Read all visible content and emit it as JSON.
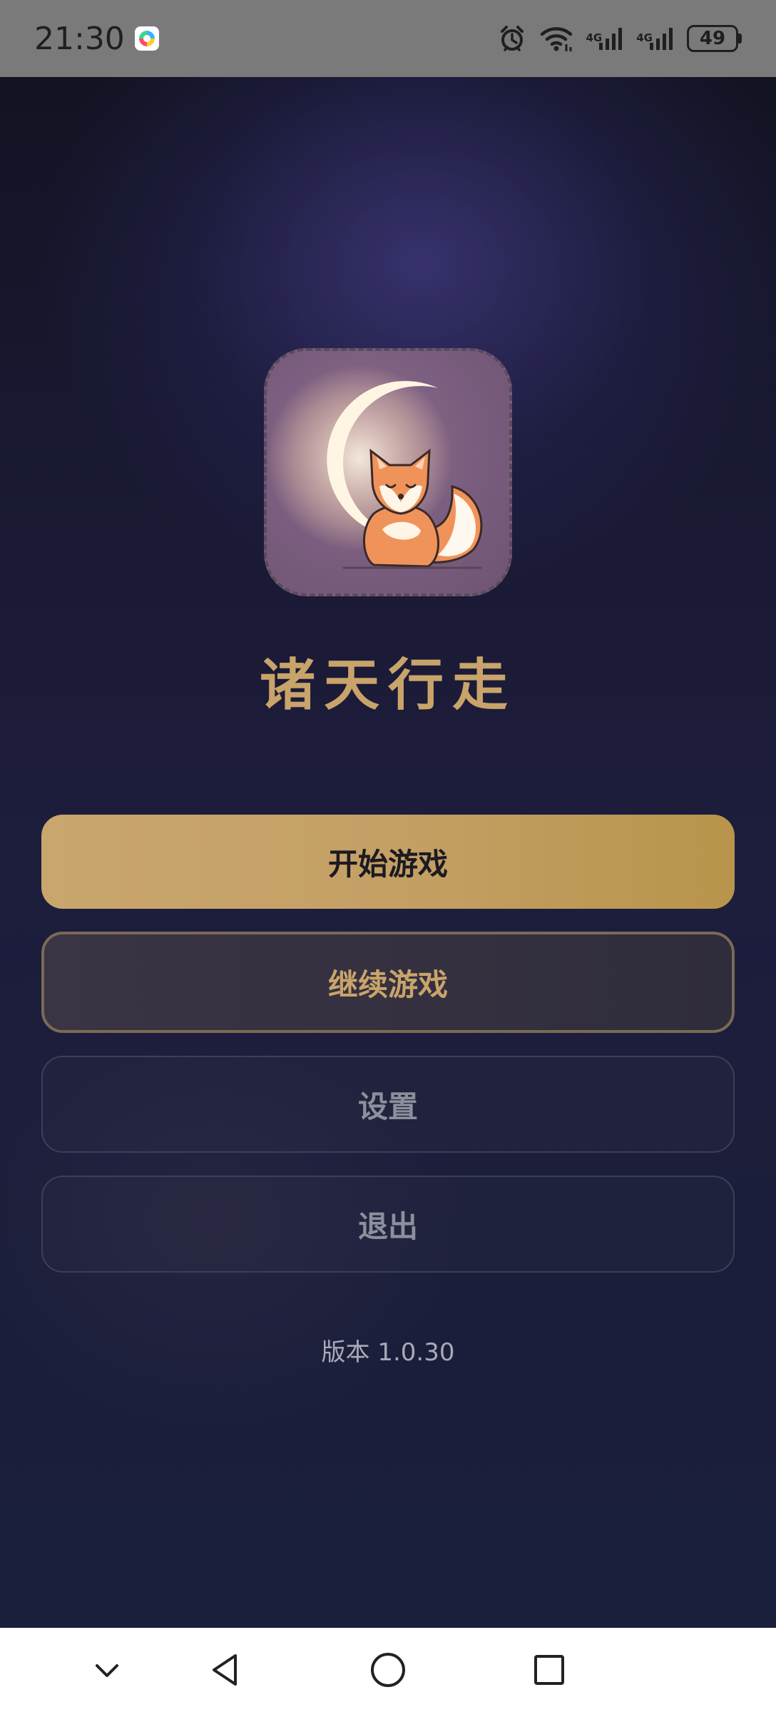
{
  "status_bar": {
    "time": "21:30",
    "app_icon": "multicolor-app-icon",
    "alarm_icon": "alarm-icon",
    "wifi_icon": "wifi-icon",
    "network1": "4G",
    "network2": "4G",
    "battery_level": "49"
  },
  "game": {
    "logo": "crescent-moon-fox-logo",
    "title": "诸天行走",
    "buttons": {
      "start": "开始游戏",
      "continue": "继续游戏",
      "settings": "设置",
      "exit": "退出"
    },
    "version": "版本 1.0.30"
  },
  "nav_bar": {
    "items": [
      "chevron-down-icon",
      "back-triangle-icon",
      "home-circle-icon",
      "recents-square-icon"
    ]
  },
  "colors": {
    "accent_gold": "#c9a46a",
    "background_dark": "#1a1a36"
  }
}
